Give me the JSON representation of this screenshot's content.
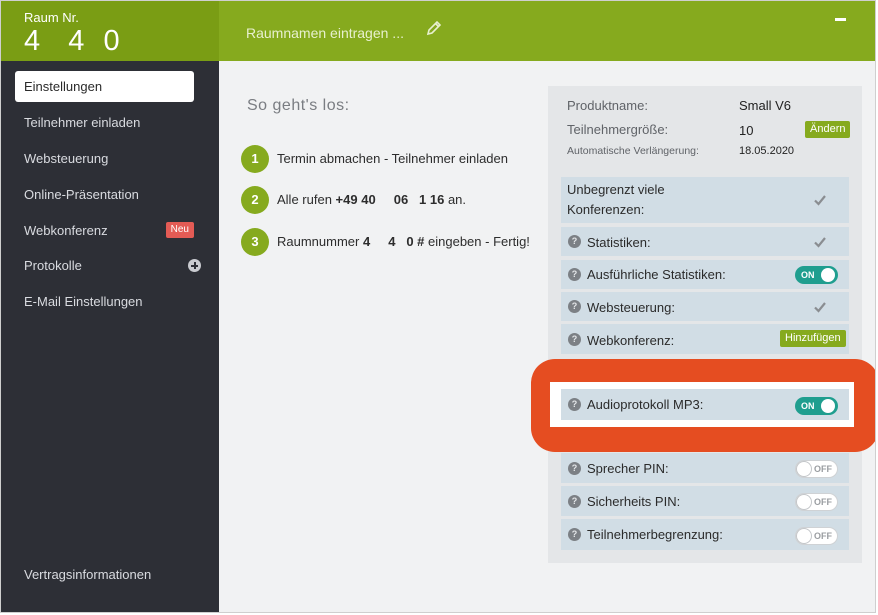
{
  "header": {
    "room_label": "Raum Nr.",
    "room_number": "4   4  0",
    "room_name_placeholder": "Raumnamen eintragen ...",
    "minimize_symbol": "–"
  },
  "sidebar": {
    "items": [
      {
        "label": "Einstellungen"
      },
      {
        "label": "Teilnehmer einladen"
      },
      {
        "label": "Websteuerung"
      },
      {
        "label": "Online-Präsentation"
      },
      {
        "label": "Webkonferenz",
        "badge": "Neu"
      },
      {
        "label": "Protokolle"
      },
      {
        "label": "E-Mail Einstellungen"
      }
    ],
    "footer": "Vertragsinformationen"
  },
  "howto": {
    "title": "So geht's los:",
    "steps": [
      {
        "num": "1",
        "text": "Termin abmachen - Teilnehmer einladen"
      },
      {
        "num": "2",
        "pre": "Alle rufen ",
        "bold": "+49 40     06   1 16",
        "post": " an."
      },
      {
        "num": "3",
        "pre": "Raumnummer ",
        "bold": "4     4   0 #",
        "post": " eingeben - Fertig!"
      }
    ]
  },
  "product": {
    "name_label": "Produktname:",
    "name_value": "Small V6",
    "size_label": "Teilnehmergröße:",
    "size_value": "10",
    "change_button": "Ändern",
    "renewal_label": "Automatische Verlängerung:",
    "renewal_value": "18.05.2020"
  },
  "features": {
    "unlimited": "Unbegrenzt viele Konferenzen:",
    "statistics": "Statistiken:",
    "detailed_statistics": "Ausführliche Statistiken:",
    "websteuerung": "Websteuerung:",
    "webkonferenz": "Webkonferenz:",
    "add_button": "Hinzufügen",
    "audio_protocol": "Audioprotokoll MP3:",
    "speaker_pin": "Sprecher PIN:",
    "security_pin": "Sicherheits PIN:",
    "participant_limit": "Teilnehmerbegrenzung:"
  },
  "toggles": {
    "on": "ON",
    "off": "OFF"
  },
  "question_symbol": "?",
  "colors": {
    "brand_green": "#86aa1e",
    "toggle_on": "#1f9e8f",
    "highlight": "#e54d21",
    "sidebar": "#2d2f36"
  }
}
